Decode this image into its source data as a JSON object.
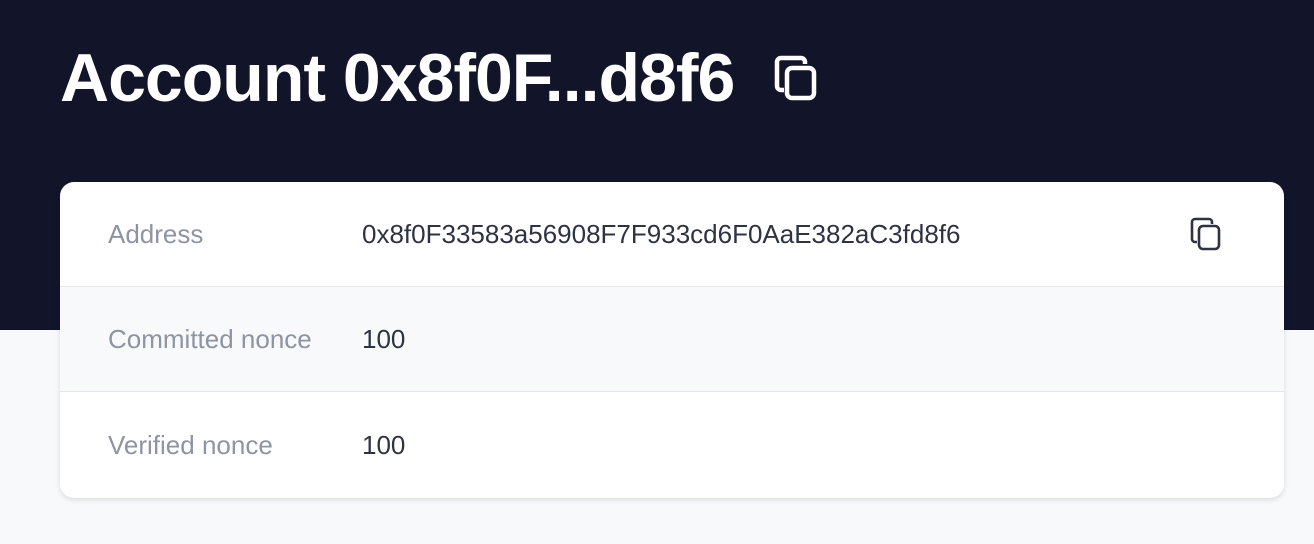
{
  "header": {
    "title": "Account 0x8f0F...d8f6",
    "copy_icon": "copy-icon"
  },
  "details": {
    "rows": [
      {
        "label": "Address",
        "value": "0x8f0F33583a56908F7F933cd6F0AaE382aC3fd8f6",
        "icon": "copy-icon"
      },
      {
        "label": "Committed nonce",
        "value": "100"
      },
      {
        "label": "Verified nonce",
        "value": "100"
      }
    ]
  },
  "colors": {
    "hero_background": "#12152a",
    "page_background": "#f8f9fb",
    "card_background": "#ffffff",
    "label_text": "#8e94a3",
    "value_text": "#2e3344"
  }
}
